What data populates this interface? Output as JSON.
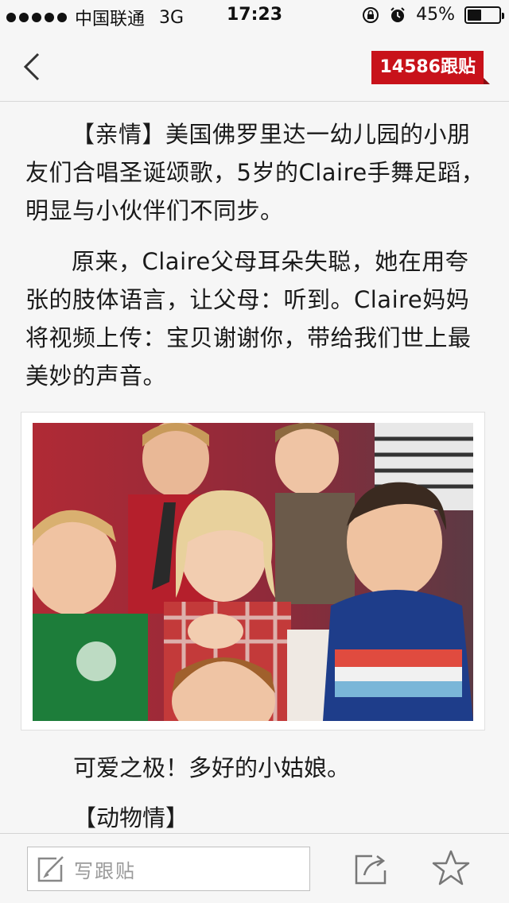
{
  "status_bar": {
    "carrier": "中国联通",
    "network": "3G",
    "time": "17:23",
    "battery": "45%",
    "battery_level": 0.45
  },
  "nav": {
    "reply_count_label": "14586跟贴",
    "accent_color": "#c8121a"
  },
  "article": {
    "paragraphs": [
      "【亲情】美国佛罗里达一幼儿园的小朋友们合唱圣诞颂歌，5岁的Claire手舞足蹈，明显与小伙伴们不同步。",
      "原来，Claire父母耳朵失聪，她在用夸张的肢体语言，让父母：听到。Claire妈妈将视频上传：宝贝谢谢你，带给我们世上最美妙的声音。"
    ],
    "caption": "可爱之极！多好的小姑娘。",
    "section_heading": "【动物情】"
  },
  "toolbar": {
    "compose_placeholder": "写跟贴"
  },
  "icons": {
    "back": "chevron-left-icon",
    "compose": "pencil-square-icon",
    "share": "share-icon",
    "favorite": "star-icon"
  }
}
